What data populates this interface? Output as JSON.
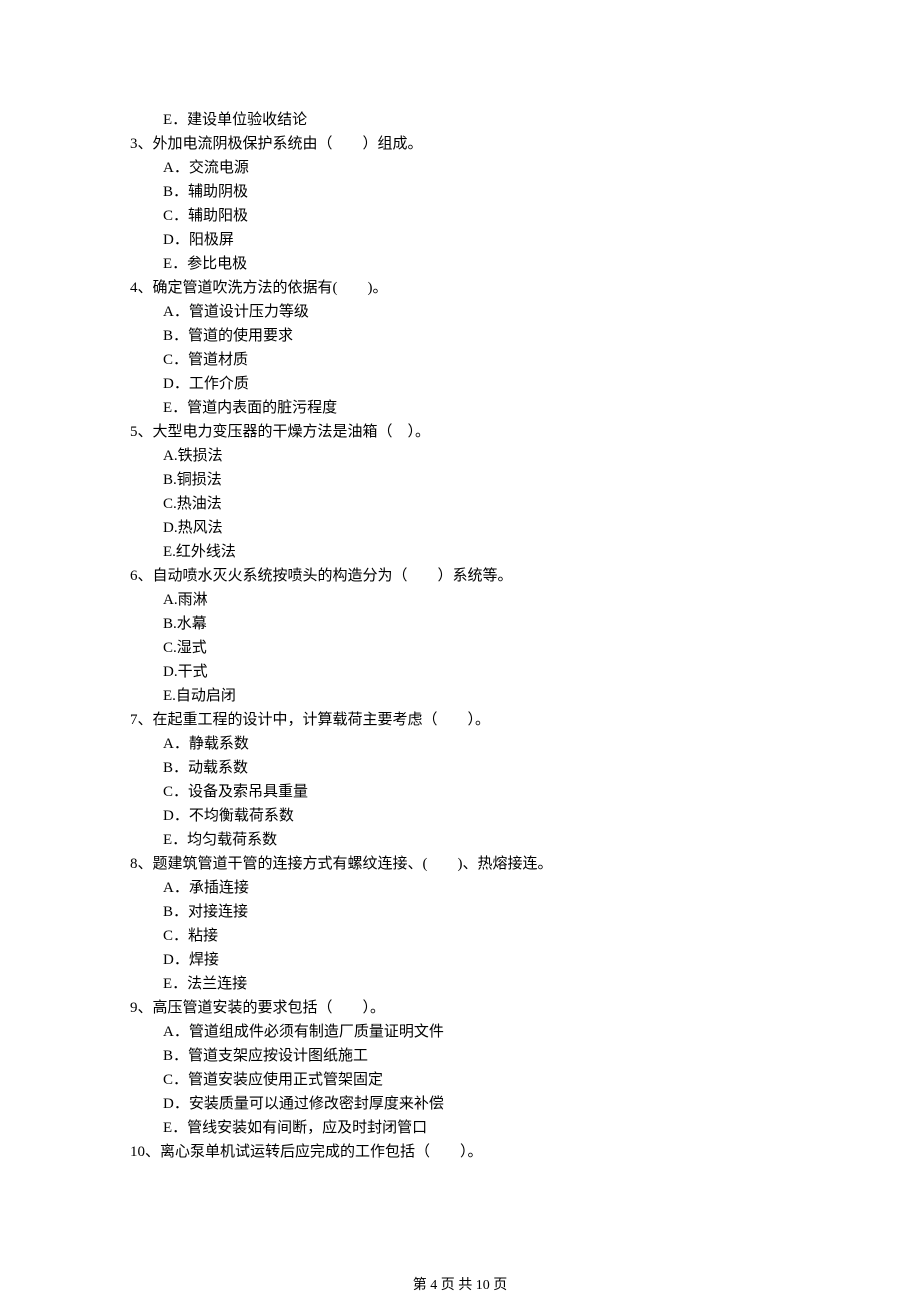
{
  "extraOption": {
    "label": "E．",
    "text": "建设单位验收结论"
  },
  "questions": [
    {
      "num": "3、",
      "stem": "外加电流阴极保护系统由（　　）组成。",
      "options": [
        {
          "label": "A．",
          "text": "交流电源"
        },
        {
          "label": "B．",
          "text": "辅助阴极"
        },
        {
          "label": "C．",
          "text": "辅助阳极"
        },
        {
          "label": "D．",
          "text": "阳极屏"
        },
        {
          "label": "E．",
          "text": "参比电极"
        }
      ]
    },
    {
      "num": "4、",
      "stem": "确定管道吹洗方法的依据有(　　)。",
      "options": [
        {
          "label": "A．",
          "text": "管道设计压力等级"
        },
        {
          "label": "B．",
          "text": "管道的使用要求"
        },
        {
          "label": "C．",
          "text": "管道材质"
        },
        {
          "label": "D．",
          "text": "工作介质"
        },
        {
          "label": "E．",
          "text": "管道内表面的脏污程度"
        }
      ]
    },
    {
      "num": "5、",
      "stem": "大型电力变压器的干燥方法是油箱（　）。",
      "options": [
        {
          "label": "A.",
          "text": "铁损法"
        },
        {
          "label": "B.",
          "text": "铜损法"
        },
        {
          "label": "C.",
          "text": "热油法"
        },
        {
          "label": "D.",
          "text": "热风法"
        },
        {
          "label": "E.",
          "text": "红外线法"
        }
      ]
    },
    {
      "num": "6、",
      "stem": "自动喷水灭火系统按喷头的构造分为（　　）系统等。",
      "options": [
        {
          "label": "A.",
          "text": "雨淋"
        },
        {
          "label": "B.",
          "text": "水幕"
        },
        {
          "label": "C.",
          "text": "湿式"
        },
        {
          "label": "D.",
          "text": "干式"
        },
        {
          "label": "E.",
          "text": "自动启闭"
        }
      ]
    },
    {
      "num": "7、",
      "stem": "在起重工程的设计中，计算载荷主要考虑（　　）。",
      "options": [
        {
          "label": "A．",
          "text": "静载系数"
        },
        {
          "label": "B．",
          "text": "动载系数"
        },
        {
          "label": "C．",
          "text": "设备及索吊具重量"
        },
        {
          "label": "D．",
          "text": "不均衡载荷系数"
        },
        {
          "label": "E．",
          "text": "均匀载荷系数"
        }
      ]
    },
    {
      "num": "8、",
      "stem": "题建筑管道干管的连接方式有螺纹连接、(　　)、热熔接连。",
      "options": [
        {
          "label": "A．",
          "text": "承插连接"
        },
        {
          "label": "B．",
          "text": "对接连接"
        },
        {
          "label": "C．",
          "text": "粘接"
        },
        {
          "label": "D．",
          "text": "焊接"
        },
        {
          "label": "E．",
          "text": "法兰连接"
        }
      ]
    },
    {
      "num": "9、",
      "stem": "高压管道安装的要求包括（　　）。",
      "options": [
        {
          "label": "A．",
          "text": "管道组成件必须有制造厂质量证明文件"
        },
        {
          "label": "B．",
          "text": "管道支架应按设计图纸施工"
        },
        {
          "label": "C．",
          "text": "管道安装应使用正式管架固定"
        },
        {
          "label": "D．",
          "text": "安装质量可以通过修改密封厚度来补偿"
        },
        {
          "label": "E．",
          "text": "管线安装如有间断，应及时封闭管口"
        }
      ]
    },
    {
      "num": "10、",
      "stem": "离心泵单机试运转后应完成的工作包括（　　）。",
      "options": []
    }
  ],
  "footer": "第 4 页 共 10 页"
}
